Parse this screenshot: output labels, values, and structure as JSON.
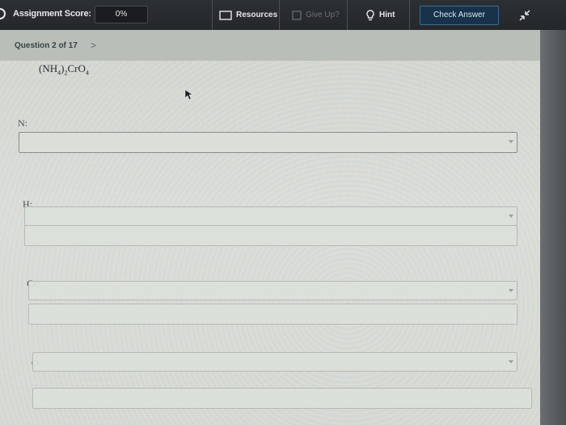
{
  "topbar": {
    "score_label": "Assignment Score:",
    "score_value": "0%",
    "resources_label": "Resources",
    "give_up_label": "Give Up?",
    "hint_label": "Hint",
    "check_answer_label": "Check Answer"
  },
  "question_nav": {
    "label": "Question 2 of 17",
    "next": ">"
  },
  "question": {
    "formula_parts": {
      "a": "(NH",
      "a_sub": "4",
      "b": ")",
      "b_sub": "2",
      "c": "CrO",
      "c_sub": "4"
    },
    "elements": [
      {
        "label": "N:",
        "value": ""
      },
      {
        "label": "H:",
        "value": ""
      },
      {
        "label": "Cr:",
        "value": ""
      },
      {
        "label": "O:",
        "value": ""
      }
    ]
  },
  "colors": {
    "topbar_bg": "#2c2f33",
    "check_button_bg": "#17324a",
    "content_bg": "#d7d9d3"
  },
  "icons": [
    "score-circle-icon",
    "resources-doc-icon",
    "give-up-flag-icon",
    "hint-lightbulb-icon",
    "collapse-arrows-icon",
    "dropdown-caret-icon",
    "mouse-pointer-icon"
  ]
}
